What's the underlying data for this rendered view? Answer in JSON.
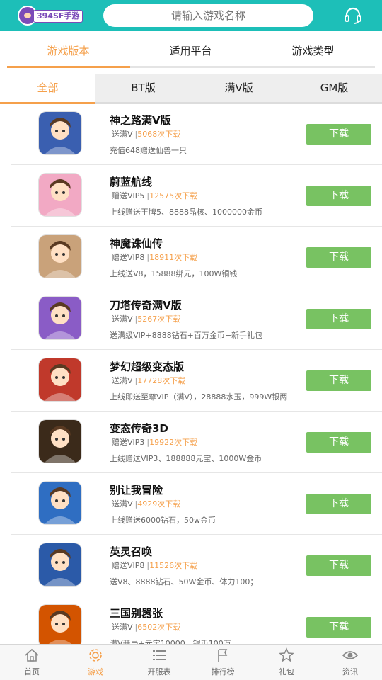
{
  "header": {
    "logo_text": "394SF手游",
    "search_placeholder": "请输入游戏名称",
    "service_icon": "headset-icon"
  },
  "filter_tabs": [
    "游戏版本",
    "适用平台",
    "游戏类型"
  ],
  "version_tabs": [
    "全部",
    "BT版",
    "满V版",
    "GM版"
  ],
  "games": [
    {
      "name": "神之路满V版",
      "tag": "送满V",
      "downloads": "5068次下载",
      "desc": "充值648赠送仙兽一只",
      "button": "下载",
      "icon_color": "#3a5fb0"
    },
    {
      "name": "蔚蓝航线",
      "tag": "赠送VIP5",
      "downloads": "12575次下载",
      "desc": "上线赠送王牌5、8888晶核、1000000金币",
      "button": "下载",
      "icon_color": "#f2a9c4"
    },
    {
      "name": "神魔诛仙传",
      "tag": "赠送VIP8",
      "downloads": "18911次下载",
      "desc": "上线送V8，15888绑元，100W铜钱",
      "button": "下载",
      "icon_color": "#c9a27a"
    },
    {
      "name": "刀塔传奇满V版",
      "tag": "送满V",
      "downloads": "5267次下载",
      "desc": "送满级VIP+8888钻石+百万金币+新手礼包",
      "button": "下载",
      "icon_color": "#8a5cc6"
    },
    {
      "name": "梦幻超级变态版",
      "tag": "送满V",
      "downloads": "17728次下载",
      "desc": "上线即送至尊VIP（满V），28888水玉，999W银两",
      "button": "下载",
      "icon_color": "#c0392b"
    },
    {
      "name": "变态传奇3D",
      "tag": "赠送VIP3",
      "downloads": "19922次下载",
      "desc": "上线赠送VIP3、188888元宝、1000W金币",
      "button": "下载",
      "icon_color": "#3b2a1a"
    },
    {
      "name": "别让我冒险",
      "tag": "送满V",
      "downloads": "4929次下载",
      "desc": "上线赠送6000钻石，50w金币",
      "button": "下载",
      "icon_color": "#2f6ec2"
    },
    {
      "name": "英灵召唤",
      "tag": "赠送VIP8",
      "downloads": "11526次下载",
      "desc": "送V8、8888钻石、50W金币、体力100；",
      "button": "下载",
      "icon_color": "#2b5aa8"
    },
    {
      "name": "三国别嚣张",
      "tag": "送满V",
      "downloads": "6502次下载",
      "desc": "满V开局+元宝10000，银币100万",
      "button": "下载",
      "icon_color": "#d35400"
    }
  ],
  "bottom_nav": [
    {
      "label": "首页",
      "icon": "home-icon"
    },
    {
      "label": "游戏",
      "icon": "game-gear-icon"
    },
    {
      "label": "开服表",
      "icon": "server-list-icon"
    },
    {
      "label": "排行榜",
      "icon": "ranking-flag-icon"
    },
    {
      "label": "礼包",
      "icon": "gift-star-icon"
    },
    {
      "label": "资讯",
      "icon": "news-eye-icon"
    }
  ],
  "colors": {
    "header": "#1dbfb8",
    "accent": "#f5a04b",
    "download_button": "#78c262"
  }
}
